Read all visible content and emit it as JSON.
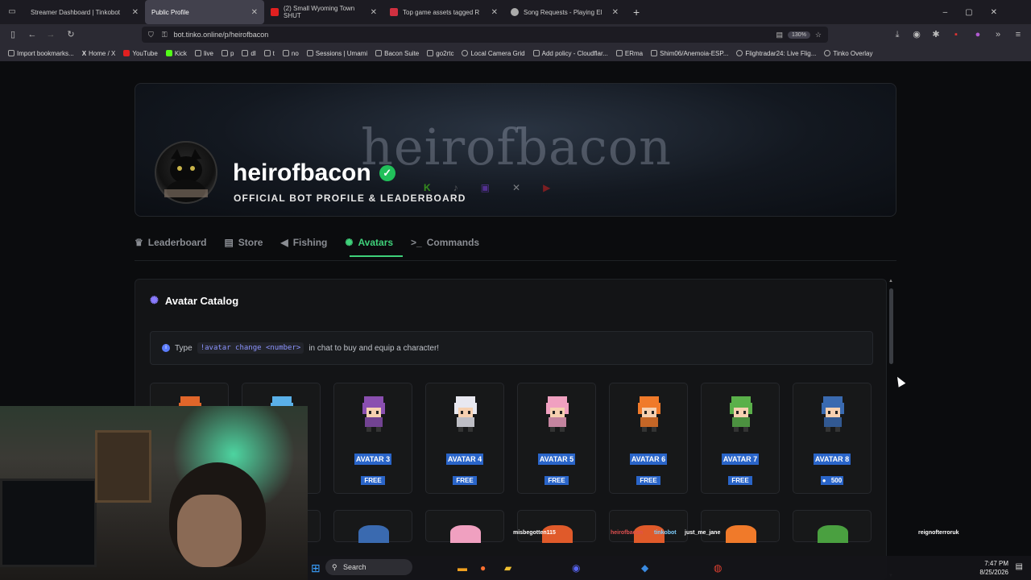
{
  "browser": {
    "tabs": [
      {
        "title": "Streamer Dashboard | Tinkobot",
        "active": false
      },
      {
        "title": "Public Profile",
        "active": true
      },
      {
        "title": "(2) Small Wyoming Town SHUT",
        "active": false
      },
      {
        "title": "Top game assets tagged R",
        "active": false
      },
      {
        "title": "Song Requests - Playing El",
        "active": false
      }
    ],
    "url": "bot.tinko.online/p/heirofbacon",
    "zoom": "130%",
    "bookmarks": [
      "Import bookmarks...",
      "Home / X",
      "YouTube",
      "Kick",
      "live",
      "p",
      "dl",
      "t",
      "no",
      "Sessions | Umami",
      "Bacon Suite",
      "go2rtc",
      "Local Camera Grid",
      "Add policy - Cloudflar...",
      "ERma",
      "Shim06/Anemoia-ESP...",
      "Flightradar24: Live Flig...",
      "Tinko Overlay"
    ]
  },
  "profile": {
    "watermark": "heirofbacon",
    "name": "heirofbacon",
    "subtitle": "OFFICIAL BOT PROFILE & LEADERBOARD"
  },
  "nav_tabs": [
    {
      "label": "Leaderboard",
      "icon": "trophy-icon",
      "active": false
    },
    {
      "label": "Store",
      "icon": "store-icon",
      "active": false
    },
    {
      "label": "Fishing",
      "icon": "fish-icon",
      "active": false
    },
    {
      "label": "Avatars",
      "icon": "avatar-icon",
      "active": true
    },
    {
      "label": "Commands",
      "icon": "terminal-icon",
      "active": false
    }
  ],
  "catalog": {
    "title": "Avatar Catalog",
    "info_prefix": "Type",
    "info_command": "!avatar change <number>",
    "info_suffix": "in chat to buy and equip a character!",
    "avatars": [
      {
        "name": "",
        "price": "",
        "color": "#e0662a"
      },
      {
        "name": "",
        "price": "",
        "color": "#5ab0e8"
      },
      {
        "name": "AVATAR 3",
        "price": "FREE",
        "color": "#8a4fb0"
      },
      {
        "name": "AVATAR 4",
        "price": "FREE",
        "color": "#e8e8f0"
      },
      {
        "name": "AVATAR 5",
        "price": "FREE",
        "color": "#f0a0c0"
      },
      {
        "name": "AVATAR 6",
        "price": "FREE",
        "color": "#f07a2a"
      },
      {
        "name": "AVATAR 7",
        "price": "FREE",
        "color": "#5ab04a"
      },
      {
        "name": "AVATAR 8",
        "price": "500",
        "color": "#3a6ab0"
      }
    ]
  },
  "taskbar": {
    "search": "Search",
    "time": "7:47 PM",
    "date": "8/25/2026"
  },
  "chat_names": [
    "misbegotten115",
    "heirofbacon",
    "tinkobot",
    "just_me_jane",
    "reignofterroruk"
  ]
}
